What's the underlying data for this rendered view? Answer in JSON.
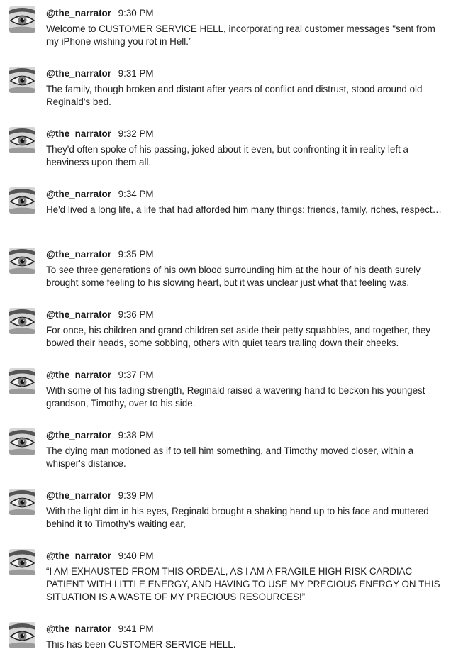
{
  "feed": {
    "messages": [
      {
        "user": "@the_narrator",
        "time": "9:30 PM",
        "text": "Welcome to CUSTOMER SERVICE HELL, incorporating real customer messages \"sent from my iPhone wishing you rot in Hell.”"
      },
      {
        "user": "@the_narrator",
        "time": "9:31 PM",
        "text": "The family, though broken and distant after years of conflict and distrust, stood around old Reginald's bed."
      },
      {
        "user": "@the_narrator",
        "time": "9:32 PM",
        "text": "They'd often spoke of his passing, joked about it even, but confronting it in reality left a heaviness upon them all."
      },
      {
        "user": "@the_narrator",
        "time": "9:34 PM",
        "text": "He'd lived a long life, a life that had afforded him many things: friends, family, riches, respect…"
      },
      {
        "user": "@the_narrator",
        "time": "9:35 PM",
        "text": "To see three generations of his own blood surrounding him at the hour of his death surely brought some feeling to his slowing heart, but it was unclear just what that feeling was."
      },
      {
        "user": "@the_narrator",
        "time": "9:36 PM",
        "text": "For once, his children and grand children set aside their petty squabbles, and together, they bowed their heads, some sobbing, others with quiet tears trailing down their cheeks."
      },
      {
        "user": "@the_narrator",
        "time": "9:37 PM",
        "text": "With some of his fading strength, Reginald raised a wavering hand to beckon his youngest grandson, Timothy, over to his side."
      },
      {
        "user": "@the_narrator",
        "time": "9:38 PM",
        "text": "The dying man motioned as if to tell him something, and Timothy moved closer, within a whisper's distance."
      },
      {
        "user": "@the_narrator",
        "time": "9:39 PM",
        "text": "With the light dim in his eyes, Reginald brought a shaking hand up to his face and muttered behind it to Timothy's waiting ear,"
      },
      {
        "user": "@the_narrator",
        "time": "9:40 PM",
        "text": "“I AM EXHAUSTED FROM THIS ORDEAL, AS I AM A FRAGILE HIGH RISK CARDIAC PATIENT WITH LITTLE ENERGY, AND HAVING TO USE MY PRECIOUS ENERGY ON THIS SITUATION IS A WASTE OF MY PRECIOUS RESOURCES!”"
      },
      {
        "user": "@the_narrator",
        "time": "9:41 PM",
        "text": "This has been CUSTOMER SERVICE HELL."
      }
    ]
  }
}
